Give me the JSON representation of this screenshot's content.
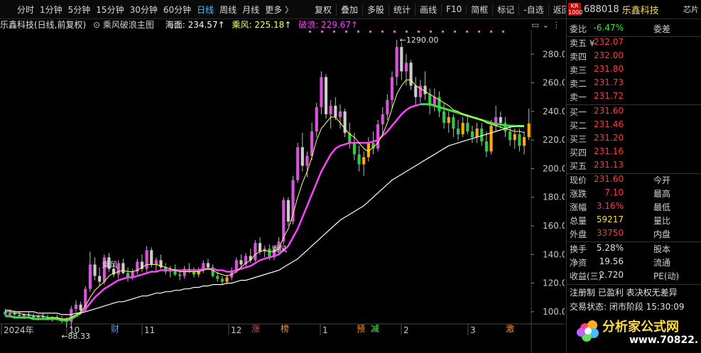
{
  "toolbar": {
    "left": [
      "分时",
      "1分钟",
      "5分钟",
      "15分钟",
      "30分钟",
      "60分钟",
      "日线",
      "周线",
      "月线",
      "更多 〉"
    ],
    "active": "日线",
    "right": [
      "复权",
      "叠加",
      "多股",
      "统计",
      "画线",
      "F10",
      "简框",
      "标记",
      "-自选",
      "返回"
    ]
  },
  "legend": {
    "stock": "乐鑫科技(日线,前复权)",
    "indicator": "乘风破浪主图",
    "hai": "海面: 234.57↑",
    "feng": "乘风: 225.18↑",
    "lang": "破浪: 229.67↑"
  },
  "chart_data": {
    "type": "candlestick",
    "y_ticks": [
      100,
      120,
      140,
      160,
      180,
      200,
      220,
      240,
      260,
      280
    ],
    "ylim": [
      93,
      297
    ],
    "x_labels": [
      "2024年",
      "10",
      "11",
      "12",
      "1",
      "2",
      "3"
    ],
    "event_marks": [
      {
        "label": "财",
        "color": "#40a0ff"
      },
      {
        "label": "涨",
        "color": "#ff4040"
      },
      {
        "label": "榜",
        "color": "#ff9020"
      },
      {
        "label": "预",
        "color": "#ff9020"
      },
      {
        "label": "减",
        "color": "#40ff40"
      },
      {
        "label": "激",
        "color": "#ff9020"
      }
    ],
    "annotations": [
      {
        "label": "1290.00",
        "note": "high"
      },
      {
        "label": "88.33",
        "note": "low"
      },
      {
        "label": "乘风",
        "note": "signal"
      },
      {
        "label": "乘风",
        "note": "signal"
      }
    ],
    "series_colors": {
      "hai": "#ffffff",
      "feng": "#ffff66",
      "lang": "#ff40ff"
    },
    "bars": [
      {
        "o": 100,
        "h": 102,
        "l": 97,
        "c": 98
      },
      {
        "o": 98,
        "h": 101,
        "l": 96,
        "c": 99
      },
      {
        "o": 99,
        "h": 101,
        "l": 97,
        "c": 98
      },
      {
        "o": 98,
        "h": 100,
        "l": 96,
        "c": 97
      },
      {
        "o": 97,
        "h": 99,
        "l": 95,
        "c": 98
      },
      {
        "o": 98,
        "h": 100,
        "l": 96,
        "c": 97
      },
      {
        "o": 97,
        "h": 99,
        "l": 95,
        "c": 96
      },
      {
        "o": 96,
        "h": 98,
        "l": 94,
        "c": 97
      },
      {
        "o": 97,
        "h": 99,
        "l": 95,
        "c": 96
      },
      {
        "o": 96,
        "h": 98,
        "l": 94,
        "c": 95
      },
      {
        "o": 95,
        "h": 97,
        "l": 93,
        "c": 96
      },
      {
        "o": 96,
        "h": 98,
        "l": 94,
        "c": 95
      },
      {
        "o": 95,
        "h": 97,
        "l": 92,
        "c": 94
      },
      {
        "o": 94,
        "h": 96,
        "l": 89,
        "c": 93
      },
      {
        "o": 93,
        "h": 104,
        "l": 88,
        "c": 102
      },
      {
        "o": 102,
        "h": 108,
        "l": 100,
        "c": 105
      },
      {
        "o": 105,
        "h": 107,
        "l": 99,
        "c": 101
      },
      {
        "o": 101,
        "h": 118,
        "l": 100,
        "c": 116
      },
      {
        "o": 116,
        "h": 142,
        "l": 114,
        "c": 133
      },
      {
        "o": 133,
        "h": 138,
        "l": 122,
        "c": 125
      },
      {
        "o": 125,
        "h": 131,
        "l": 118,
        "c": 121
      },
      {
        "o": 121,
        "h": 140,
        "l": 119,
        "c": 138
      },
      {
        "o": 138,
        "h": 141,
        "l": 128,
        "c": 130
      },
      {
        "o": 130,
        "h": 134,
        "l": 124,
        "c": 126
      },
      {
        "o": 126,
        "h": 136,
        "l": 123,
        "c": 134
      },
      {
        "o": 134,
        "h": 137,
        "l": 126,
        "c": 127
      },
      {
        "o": 127,
        "h": 131,
        "l": 121,
        "c": 124
      },
      {
        "o": 124,
        "h": 130,
        "l": 122,
        "c": 128
      },
      {
        "o": 128,
        "h": 137,
        "l": 126,
        "c": 135
      },
      {
        "o": 135,
        "h": 140,
        "l": 128,
        "c": 130
      },
      {
        "o": 130,
        "h": 146,
        "l": 128,
        "c": 143
      },
      {
        "o": 143,
        "h": 145,
        "l": 131,
        "c": 133
      },
      {
        "o": 133,
        "h": 138,
        "l": 128,
        "c": 136
      },
      {
        "o": 136,
        "h": 140,
        "l": 130,
        "c": 131
      },
      {
        "o": 131,
        "h": 134,
        "l": 126,
        "c": 128
      },
      {
        "o": 128,
        "h": 132,
        "l": 124,
        "c": 130
      },
      {
        "o": 130,
        "h": 133,
        "l": 125,
        "c": 126
      },
      {
        "o": 126,
        "h": 129,
        "l": 122,
        "c": 125
      },
      {
        "o": 125,
        "h": 132,
        "l": 123,
        "c": 130
      },
      {
        "o": 130,
        "h": 134,
        "l": 127,
        "c": 128
      },
      {
        "o": 128,
        "h": 131,
        "l": 124,
        "c": 126
      },
      {
        "o": 126,
        "h": 131,
        "l": 124,
        "c": 129
      },
      {
        "o": 129,
        "h": 136,
        "l": 127,
        "c": 134
      },
      {
        "o": 134,
        "h": 137,
        "l": 129,
        "c": 131
      },
      {
        "o": 131,
        "h": 133,
        "l": 124,
        "c": 125
      },
      {
        "o": 125,
        "h": 128,
        "l": 121,
        "c": 123
      },
      {
        "o": 123,
        "h": 125,
        "l": 119,
        "c": 121
      },
      {
        "o": 121,
        "h": 126,
        "l": 119,
        "c": 124
      },
      {
        "o": 124,
        "h": 131,
        "l": 122,
        "c": 129
      },
      {
        "o": 129,
        "h": 138,
        "l": 127,
        "c": 136
      },
      {
        "o": 136,
        "h": 140,
        "l": 131,
        "c": 133
      },
      {
        "o": 133,
        "h": 141,
        "l": 131,
        "c": 139
      },
      {
        "o": 139,
        "h": 144,
        "l": 134,
        "c": 136
      },
      {
        "o": 136,
        "h": 150,
        "l": 135,
        "c": 148
      },
      {
        "o": 148,
        "h": 152,
        "l": 140,
        "c": 142
      },
      {
        "o": 142,
        "h": 146,
        "l": 138,
        "c": 144
      },
      {
        "o": 144,
        "h": 147,
        "l": 136,
        "c": 138
      },
      {
        "o": 138,
        "h": 145,
        "l": 136,
        "c": 143
      },
      {
        "o": 143,
        "h": 152,
        "l": 141,
        "c": 149
      },
      {
        "o": 149,
        "h": 180,
        "l": 147,
        "c": 178
      },
      {
        "o": 178,
        "h": 180,
        "l": 160,
        "c": 163
      },
      {
        "o": 163,
        "h": 195,
        "l": 161,
        "c": 192
      },
      {
        "o": 192,
        "h": 218,
        "l": 190,
        "c": 215
      },
      {
        "o": 215,
        "h": 225,
        "l": 198,
        "c": 202
      },
      {
        "o": 202,
        "h": 212,
        "l": 194,
        "c": 209
      },
      {
        "o": 209,
        "h": 232,
        "l": 206,
        "c": 226
      },
      {
        "o": 226,
        "h": 246,
        "l": 222,
        "c": 243
      },
      {
        "o": 243,
        "h": 268,
        "l": 238,
        "c": 264
      },
      {
        "o": 264,
        "h": 266,
        "l": 235,
        "c": 238
      },
      {
        "o": 238,
        "h": 248,
        "l": 228,
        "c": 244
      },
      {
        "o": 244,
        "h": 250,
        "l": 234,
        "c": 236
      },
      {
        "o": 236,
        "h": 245,
        "l": 228,
        "c": 240
      },
      {
        "o": 240,
        "h": 242,
        "l": 222,
        "c": 225
      },
      {
        "o": 225,
        "h": 232,
        "l": 214,
        "c": 218
      },
      {
        "o": 218,
        "h": 225,
        "l": 206,
        "c": 210
      },
      {
        "o": 210,
        "h": 216,
        "l": 198,
        "c": 203
      },
      {
        "o": 203,
        "h": 212,
        "l": 195,
        "c": 208
      },
      {
        "o": 208,
        "h": 222,
        "l": 205,
        "c": 218
      },
      {
        "o": 218,
        "h": 226,
        "l": 210,
        "c": 214
      },
      {
        "o": 214,
        "h": 234,
        "l": 212,
        "c": 231
      },
      {
        "o": 231,
        "h": 243,
        "l": 224,
        "c": 238
      },
      {
        "o": 238,
        "h": 252,
        "l": 234,
        "c": 248
      },
      {
        "o": 248,
        "h": 268,
        "l": 242,
        "c": 264
      },
      {
        "o": 264,
        "h": 290,
        "l": 258,
        "c": 285
      },
      {
        "o": 285,
        "h": 288,
        "l": 262,
        "c": 268
      },
      {
        "o": 268,
        "h": 280,
        "l": 258,
        "c": 274
      },
      {
        "o": 274,
        "h": 276,
        "l": 255,
        "c": 258
      },
      {
        "o": 258,
        "h": 264,
        "l": 244,
        "c": 250
      },
      {
        "o": 250,
        "h": 262,
        "l": 246,
        "c": 258
      },
      {
        "o": 258,
        "h": 268,
        "l": 248,
        "c": 252
      },
      {
        "o": 252,
        "h": 256,
        "l": 238,
        "c": 244
      },
      {
        "o": 244,
        "h": 256,
        "l": 240,
        "c": 250
      },
      {
        "o": 250,
        "h": 254,
        "l": 236,
        "c": 240
      },
      {
        "o": 240,
        "h": 246,
        "l": 228,
        "c": 232
      },
      {
        "o": 232,
        "h": 240,
        "l": 225,
        "c": 236
      },
      {
        "o": 236,
        "h": 238,
        "l": 222,
        "c": 228
      },
      {
        "o": 228,
        "h": 234,
        "l": 220,
        "c": 224
      },
      {
        "o": 224,
        "h": 236,
        "l": 222,
        "c": 232
      },
      {
        "o": 232,
        "h": 238,
        "l": 224,
        "c": 226
      },
      {
        "o": 226,
        "h": 230,
        "l": 218,
        "c": 222
      },
      {
        "o": 222,
        "h": 232,
        "l": 218,
        "c": 228
      },
      {
        "o": 228,
        "h": 232,
        "l": 216,
        "c": 219
      },
      {
        "o": 219,
        "h": 226,
        "l": 208,
        "c": 212
      },
      {
        "o": 212,
        "h": 234,
        "l": 210,
        "c": 230
      },
      {
        "o": 230,
        "h": 244,
        "l": 226,
        "c": 236
      },
      {
        "o": 236,
        "h": 240,
        "l": 228,
        "c": 232
      },
      {
        "o": 232,
        "h": 236,
        "l": 222,
        "c": 226
      },
      {
        "o": 226,
        "h": 230,
        "l": 216,
        "c": 220
      },
      {
        "o": 220,
        "h": 228,
        "l": 214,
        "c": 224
      },
      {
        "o": 224,
        "h": 228,
        "l": 212,
        "c": 216
      },
      {
        "o": 216,
        "h": 226,
        "l": 210,
        "c": 222
      },
      {
        "o": 222,
        "h": 242,
        "l": 220,
        "c": 231.6
      }
    ],
    "hai": [
      101,
      101,
      100,
      100,
      100,
      100,
      100,
      99,
      99,
      99,
      99,
      99,
      98,
      98,
      98,
      99,
      99,
      100,
      101,
      102,
      103,
      104,
      105,
      106,
      107,
      107,
      108,
      109,
      110,
      111,
      111,
      112,
      113,
      113,
      114,
      114,
      115,
      115,
      116,
      116,
      117,
      117,
      118,
      118,
      119,
      119,
      119,
      120,
      120,
      121,
      122,
      122,
      123,
      124,
      125,
      126,
      127,
      128,
      129,
      131,
      133,
      135,
      137,
      140,
      143,
      146,
      149,
      152,
      155,
      158,
      161,
      164,
      166,
      168,
      170,
      172,
      174,
      177,
      180,
      183,
      186,
      189,
      192,
      194,
      196,
      198,
      200,
      202,
      204,
      206,
      208,
      210,
      212,
      214,
      216,
      217,
      218,
      219,
      220,
      221,
      222,
      223,
      224,
      225,
      226,
      227,
      228,
      229,
      229.5,
      230,
      229.67
    ],
    "feng": [
      100,
      100,
      99,
      99,
      98,
      98,
      97,
      97,
      97,
      96,
      96,
      96,
      95,
      95,
      96,
      98,
      100,
      104,
      110,
      115,
      118,
      121,
      125,
      127,
      128,
      129,
      128,
      128,
      129,
      131,
      133,
      133,
      133,
      132,
      131,
      130,
      129,
      128,
      128,
      128,
      128,
      128,
      129,
      130,
      129,
      127,
      126,
      125,
      126,
      128,
      131,
      134,
      136,
      140,
      142,
      143,
      142,
      142,
      144,
      152,
      158,
      168,
      180,
      190,
      198,
      208,
      220,
      228,
      232,
      236,
      236,
      232,
      228,
      224,
      222,
      218,
      214,
      212,
      215,
      218,
      224,
      232,
      242,
      252,
      258,
      262,
      262,
      258,
      256,
      254,
      252,
      250,
      248,
      246,
      244,
      241,
      240,
      238,
      237,
      236,
      235,
      234,
      232,
      231,
      230,
      229,
      228,
      227,
      226,
      226,
      225.18
    ],
    "lang": [
      97,
      97,
      96,
      96,
      96,
      96,
      95,
      95,
      95,
      95,
      95,
      95,
      94,
      94,
      95,
      97,
      99,
      102,
      106,
      110,
      113,
      116,
      118,
      120,
      122,
      123,
      124,
      124,
      125,
      126,
      127,
      128,
      128,
      129,
      129,
      129,
      129,
      129,
      129,
      129,
      129,
      129,
      130,
      130,
      130,
      129,
      129,
      128,
      128,
      129,
      130,
      131,
      132,
      134,
      136,
      137,
      138,
      139,
      140,
      143,
      146,
      152,
      158,
      166,
      174,
      182,
      190,
      198,
      204,
      210,
      214,
      216,
      217,
      218,
      218,
      218,
      218,
      218,
      219,
      220,
      223,
      226,
      230,
      234,
      238,
      241,
      243,
      244,
      245,
      245,
      245,
      244,
      243,
      242,
      241,
      240,
      239,
      238,
      237,
      236,
      235,
      234,
      233,
      232,
      231,
      231,
      230,
      230,
      229.8,
      229.7,
      229.67
    ]
  },
  "quote": {
    "code": "688018",
    "name": "乐鑫科技",
    "tag": "芯片",
    "kr": "KR",
    "kr2": "1000",
    "weibi_label": "委比",
    "weibi_value": "-6.47%",
    "weicha_label": "委差",
    "asks": [
      {
        "label": "卖五 ¥",
        "price": "232.07"
      },
      {
        "label": "卖四",
        "price": "232.00"
      },
      {
        "label": "卖三",
        "price": "231.80"
      },
      {
        "label": "卖二",
        "price": "231.73"
      },
      {
        "label": "卖一",
        "price": "231.72"
      }
    ],
    "bids": [
      {
        "label": "买一",
        "price": "231.60"
      },
      {
        "label": "买二",
        "price": "231.46"
      },
      {
        "label": "买三",
        "price": "231.20"
      },
      {
        "label": "买四",
        "price": "231.16"
      },
      {
        "label": "买五",
        "price": "231.13"
      }
    ],
    "stats": [
      {
        "l1": "现价",
        "v": "231.60",
        "c": "red",
        "l2": "今开"
      },
      {
        "l1": "涨跌",
        "v": "7.10",
        "c": "red",
        "l2": "最高"
      },
      {
        "l1": "涨幅",
        "v": "3.16%",
        "c": "red",
        "l2": "最低"
      },
      {
        "l1": "总量",
        "v": "59217",
        "c": "yellow",
        "l2": "量比"
      },
      {
        "l1": "外盘",
        "v": "33750",
        "c": "red",
        "l2": "内盘"
      }
    ],
    "stats2": [
      {
        "l1": "换手",
        "v": "5.28%",
        "l2": "股本"
      },
      {
        "l1": "净资",
        "v": "19.56",
        "l2": "流通"
      },
      {
        "l1": "收益(三)",
        "v": "2.720",
        "l2": "PE(动)"
      }
    ],
    "footer1": "注册制  已盈利  表决权无差异",
    "footer2": "交易状态: 闭市阶段 15:30:09",
    "logo_text": "分析家公式网",
    "logo_url": "www.70822.com"
  }
}
